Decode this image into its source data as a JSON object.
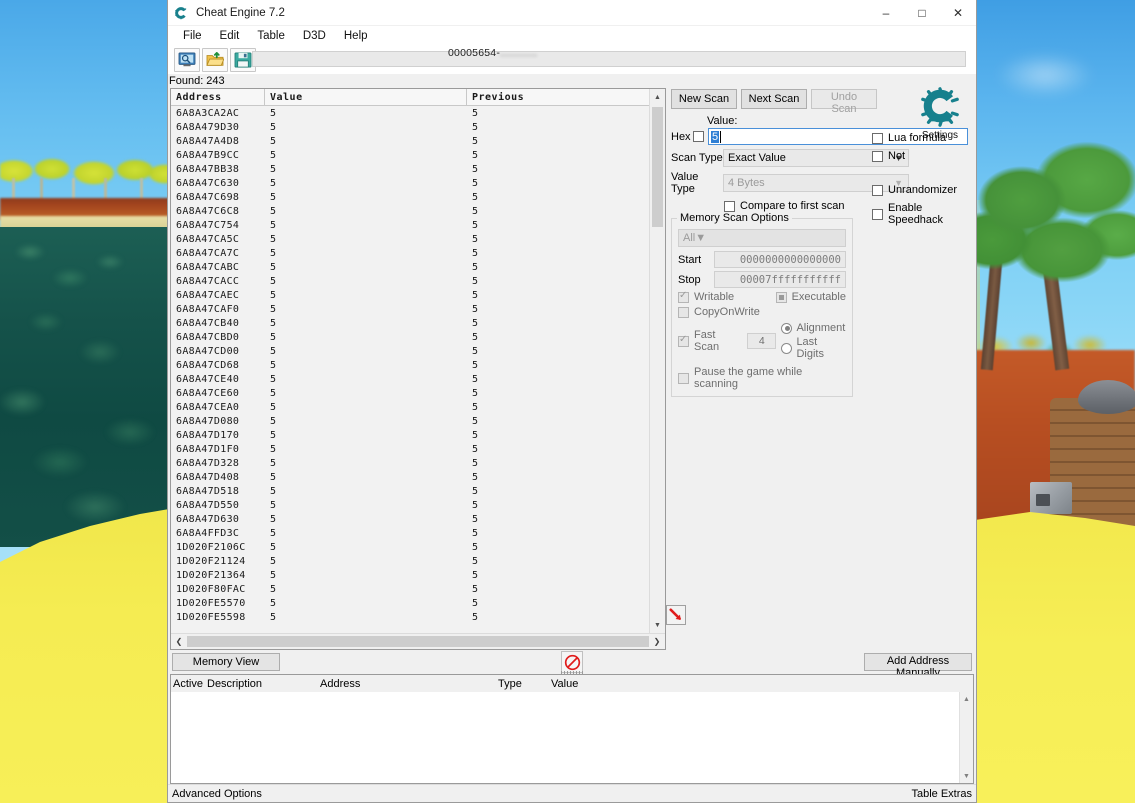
{
  "window": {
    "title": "Cheat Engine 7.2",
    "app_icon": "cheat-engine-logo-icon",
    "minimize": "–",
    "maximize": "□",
    "close": "✕"
  },
  "menu": [
    "File",
    "Edit",
    "Table",
    "D3D",
    "Help"
  ],
  "toolbar": {
    "buttons": [
      {
        "name": "select-process-button",
        "icon": "monitor-icon"
      },
      {
        "name": "open-file-button",
        "icon": "open-folder-icon"
      },
      {
        "name": "save-file-button",
        "icon": "floppy-disk-icon"
      }
    ],
    "process_id": "00005654-",
    "process_name_obscured": "............"
  },
  "found_label": "Found: 243",
  "address_list": {
    "columns": [
      "Address",
      "Value",
      "Previous"
    ],
    "rows": [
      {
        "address": "6A8A3CA2AC",
        "value": "5",
        "previous": "5"
      },
      {
        "address": "6A8A479D30",
        "value": "5",
        "previous": "5"
      },
      {
        "address": "6A8A47A4D8",
        "value": "5",
        "previous": "5"
      },
      {
        "address": "6A8A47B9CC",
        "value": "5",
        "previous": "5"
      },
      {
        "address": "6A8A47BB38",
        "value": "5",
        "previous": "5"
      },
      {
        "address": "6A8A47C630",
        "value": "5",
        "previous": "5"
      },
      {
        "address": "6A8A47C698",
        "value": "5",
        "previous": "5"
      },
      {
        "address": "6A8A47C6C8",
        "value": "5",
        "previous": "5"
      },
      {
        "address": "6A8A47C754",
        "value": "5",
        "previous": "5"
      },
      {
        "address": "6A8A47CA5C",
        "value": "5",
        "previous": "5"
      },
      {
        "address": "6A8A47CA7C",
        "value": "5",
        "previous": "5"
      },
      {
        "address": "6A8A47CABC",
        "value": "5",
        "previous": "5"
      },
      {
        "address": "6A8A47CACC",
        "value": "5",
        "previous": "5"
      },
      {
        "address": "6A8A47CAEC",
        "value": "5",
        "previous": "5"
      },
      {
        "address": "6A8A47CAF0",
        "value": "5",
        "previous": "5"
      },
      {
        "address": "6A8A47CB40",
        "value": "5",
        "previous": "5"
      },
      {
        "address": "6A8A47CBD0",
        "value": "5",
        "previous": "5"
      },
      {
        "address": "6A8A47CD00",
        "value": "5",
        "previous": "5"
      },
      {
        "address": "6A8A47CD68",
        "value": "5",
        "previous": "5"
      },
      {
        "address": "6A8A47CE40",
        "value": "5",
        "previous": "5"
      },
      {
        "address": "6A8A47CE60",
        "value": "5",
        "previous": "5"
      },
      {
        "address": "6A8A47CEA0",
        "value": "5",
        "previous": "5"
      },
      {
        "address": "6A8A47D080",
        "value": "5",
        "previous": "5"
      },
      {
        "address": "6A8A47D170",
        "value": "5",
        "previous": "5"
      },
      {
        "address": "6A8A47D1F0",
        "value": "5",
        "previous": "5"
      },
      {
        "address": "6A8A47D328",
        "value": "5",
        "previous": "5"
      },
      {
        "address": "6A8A47D408",
        "value": "5",
        "previous": "5"
      },
      {
        "address": "6A8A47D518",
        "value": "5",
        "previous": "5"
      },
      {
        "address": "6A8A47D550",
        "value": "5",
        "previous": "5"
      },
      {
        "address": "6A8A47D630",
        "value": "5",
        "previous": "5"
      },
      {
        "address": "6A8A4FFD3C",
        "value": "5",
        "previous": "5"
      },
      {
        "address": "1D020F2106C",
        "value": "5",
        "previous": "5"
      },
      {
        "address": "1D020F21124",
        "value": "5",
        "previous": "5"
      },
      {
        "address": "1D020F21364",
        "value": "5",
        "previous": "5"
      },
      {
        "address": "1D020F80FAC",
        "value": "5",
        "previous": "5"
      },
      {
        "address": "1D020FE5570",
        "value": "5",
        "previous": "5"
      },
      {
        "address": "1D020FE5598",
        "value": "5",
        "previous": "5"
      }
    ]
  },
  "scan_panel": {
    "new_scan": "New Scan",
    "next_scan": "Next Scan",
    "undo_scan": "Undo Scan",
    "settings_label": "Settings",
    "settings_icon": "cheat-engine-gear-icon",
    "value_label": "Value:",
    "hex_label": "Hex",
    "hex_checked": false,
    "value_input": "5",
    "scan_type_label": "Scan Type",
    "scan_type_value": "Exact Value",
    "value_type_label": "Value Type",
    "value_type_value": "4 Bytes",
    "compare_first_scan": "Compare to first scan",
    "compare_first_scan_checked": false,
    "lua_formula": "Lua formula",
    "lua_formula_checked": false,
    "not_label": "Not",
    "not_checked": false,
    "unrandomizer": "Unrandomizer",
    "unrandomizer_checked": false,
    "enable_speedhack": "Enable Speedhack",
    "enable_speedhack_checked": false
  },
  "memory_scan_options": {
    "title": "Memory Scan Options",
    "region": "All",
    "start_label": "Start",
    "start_value": "0000000000000000",
    "stop_label": "Stop",
    "stop_value": "00007fffffffffff",
    "writable": "Writable",
    "writable_checked": true,
    "executable": "Executable",
    "executable_state": "indeterminate",
    "copyonwrite": "CopyOnWrite",
    "copyonwrite_checked": false,
    "fast_scan": "Fast Scan",
    "fast_scan_checked": true,
    "fast_scan_value": "4",
    "alignment": "Alignment",
    "alignment_selected": true,
    "last_digits": "Last Digits",
    "last_digits_selected": false,
    "pause_game": "Pause the game while scanning",
    "pause_game_checked": false
  },
  "mid_bar": {
    "memory_view": "Memory View",
    "add_address_manually": "Add Address Manually",
    "stop_icon": "no-entry-icon",
    "add_arrow_icon": "red-arrow-down-right-icon"
  },
  "cheat_table": {
    "columns": [
      "Active",
      "Description",
      "Address",
      "Type",
      "Value"
    ],
    "rows": []
  },
  "status_bar": {
    "advanced_options": "Advanced Options",
    "table_extras": "Table Extras"
  }
}
